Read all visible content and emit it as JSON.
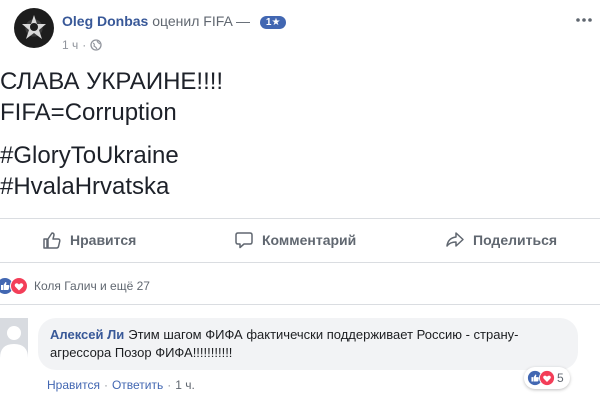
{
  "post": {
    "author": "Oleg Donbas",
    "action": "оценил",
    "page": "FIFA",
    "dash": "—",
    "badge": "1",
    "time": "1 ч",
    "dot": "·",
    "lines": [
      "СЛАВА УКРАИНЕ!!!!",
      "FIFA=Corruption",
      "#GloryToUkraine",
      "#HvalaHrvatska"
    ]
  },
  "actions": {
    "like_label": "Нравится",
    "comment_label": "Комментарий",
    "share_label": "Поделиться"
  },
  "reactions": {
    "summary": "Коля Галич и ещё 27"
  },
  "comment": {
    "author": "Алексей Ли",
    "text": "Этим шагом ФИФА фактичечски поддерживает Россию - страну-агрессора Позор ФИФА!!!!!!!!!!!",
    "like_link": "Нравится",
    "reply_link": "Ответить",
    "time": "1 ч.",
    "sep": "·",
    "reaction_count": "5"
  },
  "colors": {
    "link": "#385898",
    "like_blue": "#4267b2",
    "love_red": "#f33e58",
    "muted": "#606770"
  },
  "icons": {
    "avatar": "logo-avatar",
    "globe": "globe-icon",
    "like": "thumbs-up-icon",
    "comment": "comment-bubble-icon",
    "share": "share-arrow-icon",
    "menu": "more-menu-icon"
  }
}
